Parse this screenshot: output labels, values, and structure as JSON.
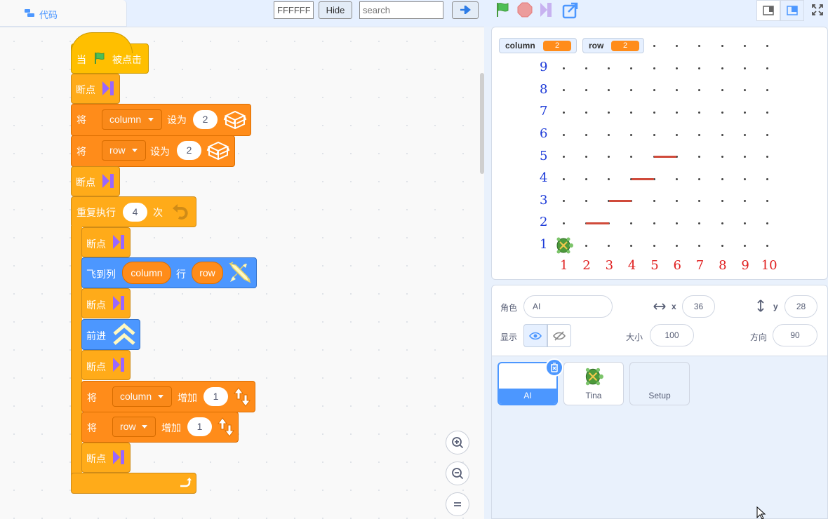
{
  "top_bar": {
    "code_tab_label": "代码",
    "color_input_value": "FFFFFF",
    "hide_button_label": "Hide",
    "search_placeholder": "search",
    "go_icon": "arrow-right-icon",
    "green_flag_icon": "green-flag-icon",
    "stop_icon": "stop-icon",
    "step_icon": "step-icon",
    "share_icon": "share-icon",
    "layout_small_icon": "small-stage-icon",
    "layout_large_icon": "large-stage-icon",
    "fullscreen_icon": "fullscreen-icon"
  },
  "script": {
    "hat_when": "当",
    "hat_clicked": "被点击",
    "breakpoint": "断点",
    "set_prefix": "将",
    "set_to": "设为",
    "set_column_var": "column",
    "set_column_value": "2",
    "set_row_var": "row",
    "set_row_value": "2",
    "repeat_label": "重复执行",
    "repeat_count": "4",
    "repeat_times": "次",
    "fly_to_prefix": "飞到列",
    "fly_to_mid": "行",
    "fly_column_reporter": "column",
    "fly_row_reporter": "row",
    "forward_label": "前进",
    "change_by": "增加",
    "change_column_var": "column",
    "change_column_value": "1",
    "change_row_var": "row",
    "change_row_value": "1",
    "colors": {
      "events": "#ffbf00",
      "variables": "#ff8c1a",
      "control": "#ffab19",
      "motion": "#4c97ff",
      "breakpoint_icon": "#9966ff"
    }
  },
  "zoom": {
    "zoom_in_icon": "zoom-in-icon",
    "zoom_out_icon": "zoom-out-icon",
    "reset_icon": "zoom-reset-icon"
  },
  "stage": {
    "monitors": [
      {
        "name": "column",
        "value": "2"
      },
      {
        "name": "row",
        "value": "2"
      }
    ],
    "y_labels": [
      "9",
      "8",
      "7",
      "6",
      "5",
      "4",
      "3",
      "2",
      "1"
    ],
    "x_labels": [
      "1",
      "2",
      "3",
      "4",
      "5",
      "6",
      "7",
      "8",
      "9",
      "10"
    ],
    "drawn_segments": [
      {
        "from": [
          2,
          2
        ],
        "to": [
          3,
          2
        ]
      },
      {
        "from": [
          3,
          3
        ],
        "to": [
          4,
          3
        ]
      },
      {
        "from": [
          4,
          4
        ],
        "to": [
          5,
          4
        ]
      },
      {
        "from": [
          5,
          5
        ],
        "to": [
          6,
          5
        ]
      }
    ],
    "turtle_icon": "turtle-sprite-icon",
    "line_color": "#d04a3a"
  },
  "sprite_info": {
    "sprite_label": "角色",
    "sprite_name": "AI",
    "x_label": "x",
    "x_value": "36",
    "y_label": "y",
    "y_value": "28",
    "show_label": "显示",
    "size_label": "大小",
    "size_value": "100",
    "direction_label": "方向",
    "direction_value": "90"
  },
  "sprites": [
    {
      "name": "AI",
      "selected": true
    },
    {
      "name": "Tina",
      "selected": false
    },
    {
      "name": "Setup",
      "selected": false
    }
  ]
}
